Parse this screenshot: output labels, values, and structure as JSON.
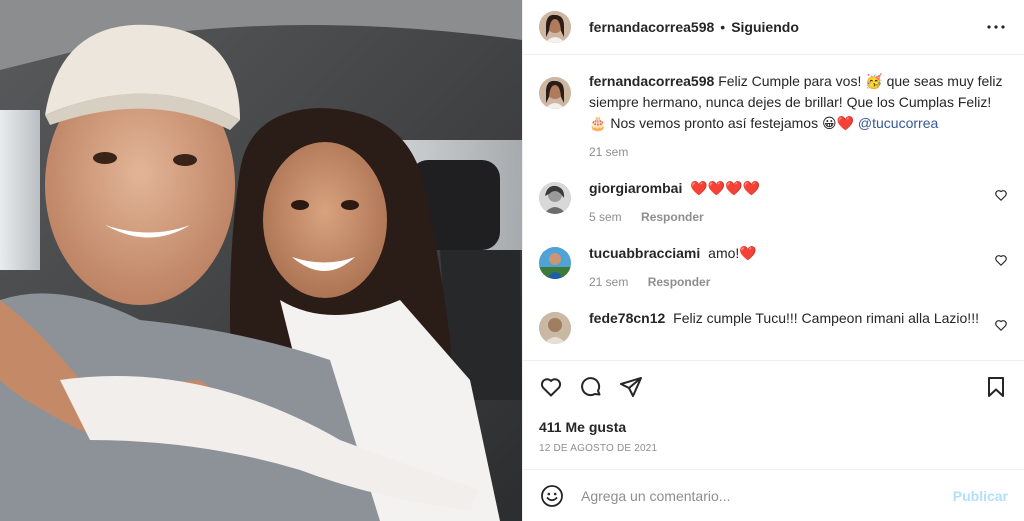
{
  "post": {
    "author": "fernandacorrea598",
    "dot": "•",
    "follow_status": "Siguiendo"
  },
  "caption": {
    "author": "fernandacorrea598",
    "text_1": "Feliz Cumple para vos! ",
    "emoji_1": "🥳",
    "text_2": " que seas muy feliz siempre hermano, nunca dejes de brillar! Que los Cumplas Feliz! ",
    "emoji_2": "🎂",
    "text_3": " Nos vemos pronto así festejamos ",
    "emoji_3": "😀❤️",
    "mention": "@tucucorrea",
    "time": "21 sem"
  },
  "comments": [
    {
      "author": "giorgiarombai",
      "text": "❤️❤️❤️❤️",
      "time": "5 sem",
      "reply": "Responder"
    },
    {
      "author": "tucuabbracciami",
      "text": "amo!❤️",
      "time": "21 sem",
      "reply": "Responder"
    },
    {
      "author": "fede78cn12",
      "text": "Feliz cumple Tucu!!! Campeon rimani alla Lazio!!!",
      "time": "",
      "reply": ""
    }
  ],
  "engagement": {
    "likes": "411 Me gusta",
    "date": "12 DE AGOSTO DE 2021"
  },
  "composer": {
    "placeholder": "Agrega un comentario...",
    "publish": "Publicar"
  },
  "icons": {
    "more": "more-horizontal-icon",
    "like": "heart-outline-icon",
    "comment": "comment-bubble-icon",
    "share": "paper-plane-icon",
    "save": "bookmark-icon",
    "emoji": "smiley-icon"
  },
  "colors": {
    "text": "#262626",
    "secondary": "#8e8e8e",
    "mention": "#385898",
    "publish_disabled": "#b2dffc",
    "heart": "#ed4956"
  }
}
